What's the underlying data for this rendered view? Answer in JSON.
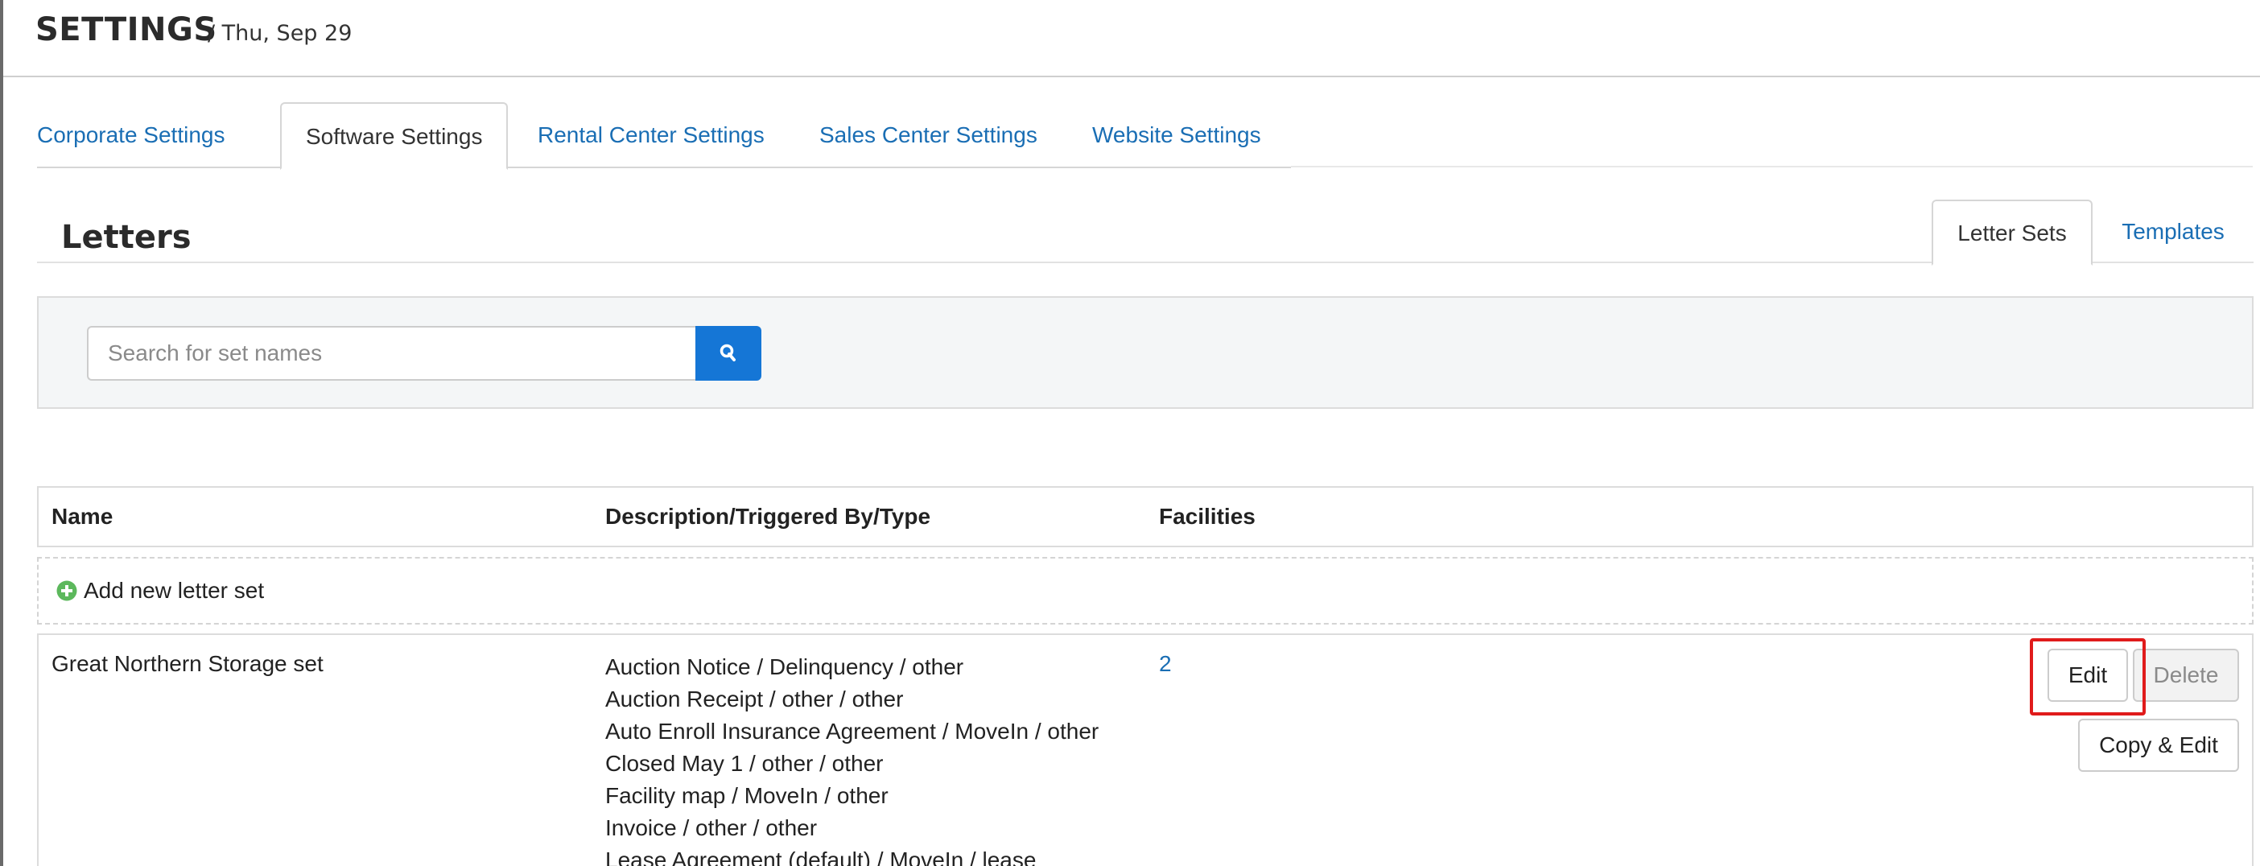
{
  "header": {
    "title": "SETTINGS",
    "date": "/ Thu, Sep 29"
  },
  "tabs": [
    {
      "label": "Corporate Settings",
      "active": false
    },
    {
      "label": "Software Settings",
      "active": true
    },
    {
      "label": "Rental Center Settings",
      "active": false
    },
    {
      "label": "Sales Center Settings",
      "active": false
    },
    {
      "label": "Website Settings",
      "active": false
    }
  ],
  "section": {
    "title": "Letters",
    "subtabs": [
      {
        "label": "Letter Sets",
        "active": true
      },
      {
        "label": "Templates",
        "active": false
      }
    ]
  },
  "search": {
    "placeholder": "Search for set names",
    "value": "",
    "button_icon": "search-icon"
  },
  "table": {
    "columns": [
      "Name",
      "Description/Triggered By/Type",
      "Facilities"
    ],
    "add_label": "Add new letter set",
    "rows": [
      {
        "name": "Great Northern Storage set",
        "descriptions": [
          "Auction Notice / Delinquency / other",
          "Auction Receipt / other / other",
          "Auto Enroll Insurance Agreement / MoveIn / other",
          "Closed May 1 / other / other",
          "Facility map / MoveIn / other",
          "Invoice / other / other",
          "Lease Agreement (default) / MoveIn / lease"
        ],
        "facilities": "2",
        "actions": {
          "edit": "Edit",
          "delete": "Delete",
          "copy_edit": "Copy & Edit"
        }
      }
    ]
  },
  "colors": {
    "link": "#1a6eb4",
    "primary_button": "#1576d6",
    "add_icon": "#5cb85c",
    "highlight": "#e01b1b"
  }
}
